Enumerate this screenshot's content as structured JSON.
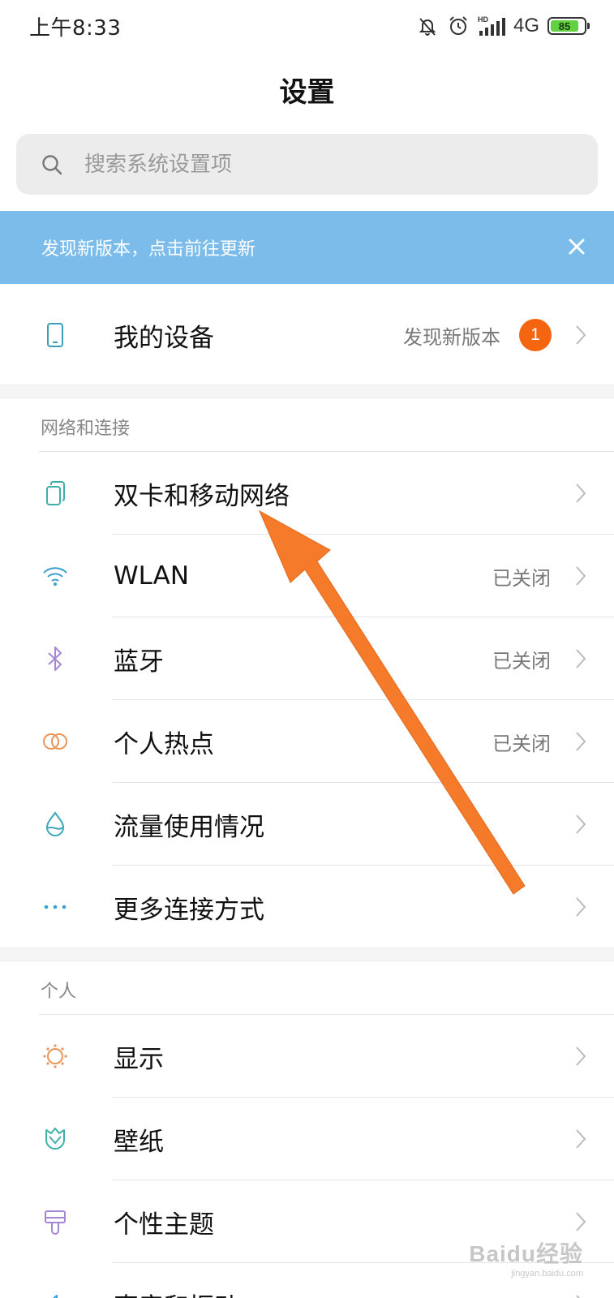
{
  "status_bar": {
    "time": "上午8:33",
    "network": "4G",
    "signal_label": "HD",
    "battery_level": "85",
    "icons": [
      "mute-icon",
      "alarm-icon",
      "signal-icon",
      "battery-icon"
    ]
  },
  "header": {
    "title": "设置"
  },
  "search": {
    "placeholder": "搜索系统设置项"
  },
  "banner": {
    "text": "发现新版本，点击前往更新",
    "background": "#7bbcea"
  },
  "device": {
    "label": "我的设备",
    "status": "发现新版本",
    "badge_count": "1",
    "badge_color": "#f5640f"
  },
  "network_section": {
    "header": "网络和连接",
    "items": [
      {
        "label": "双卡和移动网络",
        "status": "",
        "icon": "dual-sim-icon"
      },
      {
        "label": "WLAN",
        "status": "已关闭",
        "icon": "wifi-icon"
      },
      {
        "label": "蓝牙",
        "status": "已关闭",
        "icon": "bluetooth-icon"
      },
      {
        "label": "个人热点",
        "status": "已关闭",
        "icon": "hotspot-icon"
      },
      {
        "label": "流量使用情况",
        "status": "",
        "icon": "data-usage-icon"
      },
      {
        "label": "更多连接方式",
        "status": "",
        "icon": "more-icon"
      }
    ]
  },
  "personal_section": {
    "header": "个人",
    "items": [
      {
        "label": "显示",
        "icon": "display-icon"
      },
      {
        "label": "壁纸",
        "icon": "wallpaper-icon"
      },
      {
        "label": "个性主题",
        "icon": "theme-icon"
      },
      {
        "label": "声音和振动",
        "icon": "sound-icon"
      }
    ]
  },
  "annotation": {
    "arrow_color": "#f57a2a"
  },
  "watermark": {
    "main": "Baidu经验",
    "sub": "jingyan.baidu.com"
  }
}
